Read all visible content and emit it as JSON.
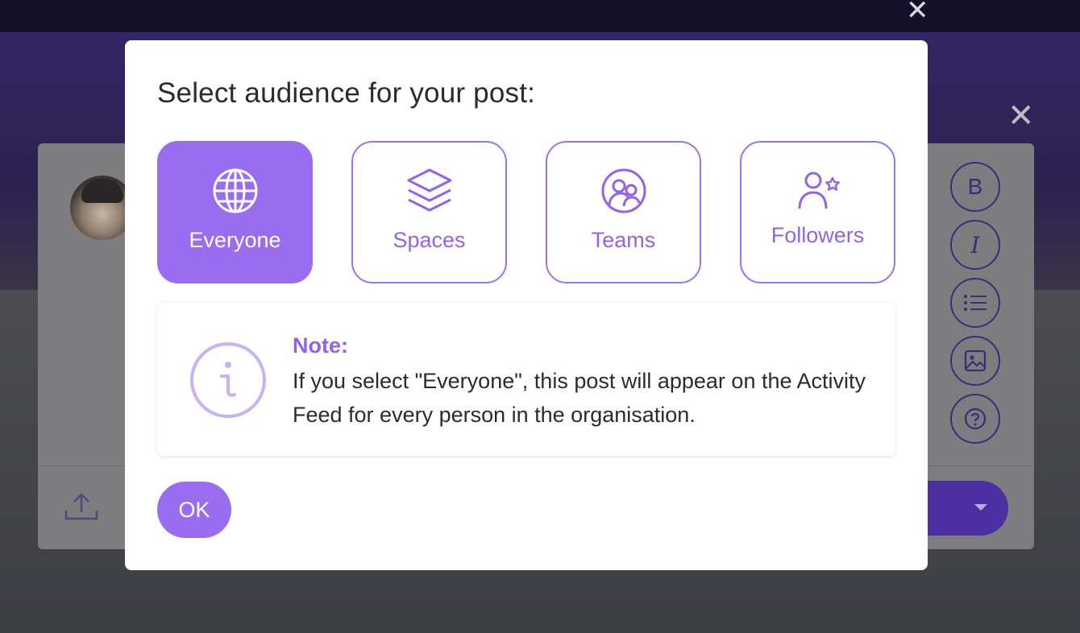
{
  "modal": {
    "title": "Select audience for your post:",
    "options": [
      {
        "label": "Everyone",
        "icon": "globe-icon",
        "selected": true
      },
      {
        "label": "Spaces",
        "icon": "layers-icon",
        "selected": false
      },
      {
        "label": "Teams",
        "icon": "team-icon",
        "selected": false
      },
      {
        "label": "Followers",
        "icon": "user-star-icon",
        "selected": false
      }
    ],
    "note": {
      "heading": "Note:",
      "text": "If you select \"Everyone\", this post will appear on the Activity Feed for every person in the organisation.",
      "icon": "info-icon"
    },
    "ok_label": "OK"
  },
  "background": {
    "toolbar_buttons": [
      "B",
      "I",
      "list",
      "image",
      "?"
    ]
  },
  "colors": {
    "accent": "#9a6cef",
    "accent_text": "#9263ea",
    "overlay_top": "#14102a",
    "text_dark": "#2a2a33"
  }
}
